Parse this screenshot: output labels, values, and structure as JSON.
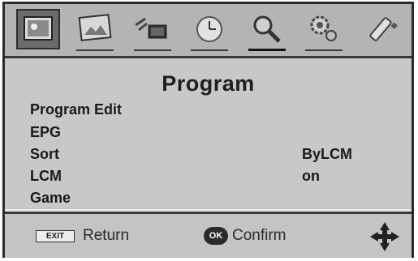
{
  "tabs": [
    {
      "icon": "picture-icon",
      "active": true
    },
    {
      "icon": "photo-icon",
      "active": false
    },
    {
      "icon": "channel-tv-icon",
      "active": false
    },
    {
      "icon": "clock-icon",
      "active": false
    },
    {
      "icon": "magnifier-tools-icon",
      "active": false
    },
    {
      "icon": "settings-gears-icon",
      "active": false
    },
    {
      "icon": "usb-stick-icon",
      "active": false
    }
  ],
  "menu": {
    "title": "Program",
    "items": [
      {
        "label": "Program Edit",
        "value": ""
      },
      {
        "label": "EPG",
        "value": ""
      },
      {
        "label": "Sort",
        "value": "ByLCM"
      },
      {
        "label": "LCM",
        "value": "on"
      },
      {
        "label": "Game",
        "value": ""
      }
    ]
  },
  "footer": {
    "exit_key": "EXIT",
    "return_label": "Return",
    "ok_key": "OK",
    "confirm_label": "Confirm"
  }
}
